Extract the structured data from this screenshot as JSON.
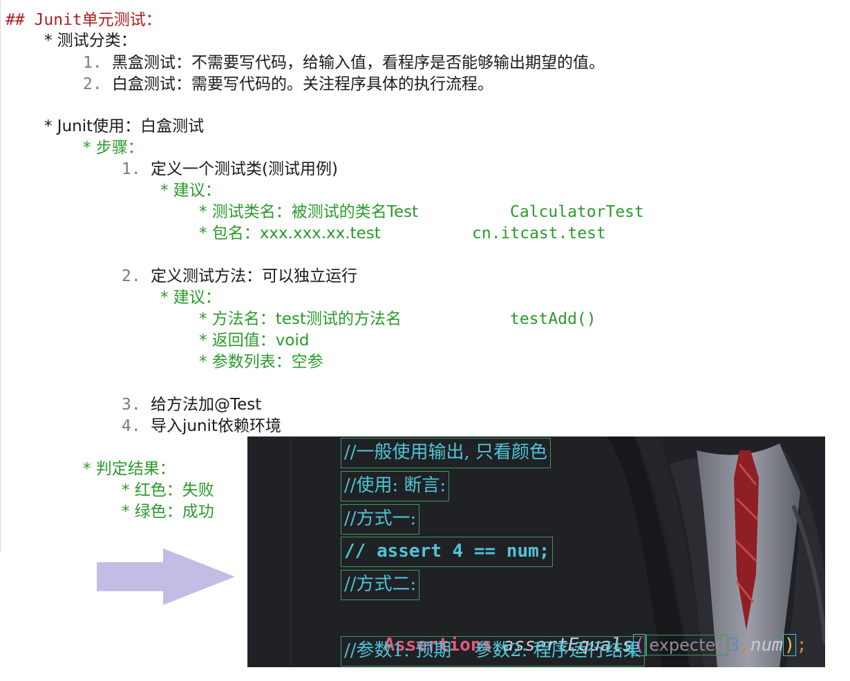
{
  "notes": {
    "heading": "## Junit单元测试：",
    "cat_title": "* 测试分类：",
    "cat_1_num": "1.",
    "cat_1": "黑盒测试：不需要写代码，给输入值，看程序是否能够输出期望的值。",
    "cat_2_num": "2.",
    "cat_2": "白盒测试：需要写代码的。关注程序具体的执行流程。",
    "use_title": "* Junit使用：白盒测试",
    "steps_title": "* 步骤：",
    "step1_num": "1.",
    "step1": "定义一个测试类(测试用例)",
    "suggest_1": "* 建议：",
    "s1_a": "* 测试类名：被测试的类名Test",
    "s1_a_ex": "CalculatorTest",
    "s1_b": "* 包名：xxx.xxx.xx.test",
    "s1_b_ex": "cn.itcast.test",
    "step2_num": "2.",
    "step2": "定义测试方法：可以独立运行",
    "suggest_2": "* 建议：",
    "s2_a": "* 方法名：test测试的方法名",
    "s2_a_ex": "testAdd()",
    "s2_b": "* 返回值：void",
    "s2_c": "* 参数列表：空参",
    "step3_num": "3.",
    "step3": "给方法加@Test",
    "step4_num": "4.",
    "step4": "导入junit依赖环境",
    "result_title": "* 判定结果：",
    "result_red": "* 红色：失败",
    "result_green": "* 绿色：成功"
  },
  "code": {
    "line1": "//一般使用输出, 只看颜色",
    "line2": "//使用: 断言:",
    "line3": "//方式一:",
    "line4": "// assert 4 == num;",
    "line5": "//方式二:",
    "line6_class": "Assertions",
    "line6_dot": ".",
    "line6_method": "assertEquals",
    "line6_open": "(",
    "line6_hint": "expected",
    "line6_arg1": "3",
    "line6_comma": ",",
    "line6_arg2": "num",
    "line6_close": ")",
    "line6_semi": ";",
    "line7": "//参数1: 预期    参数2: 程序运行结果"
  },
  "colors": {
    "heading": "#b01e1e",
    "green_text": "#2a9a2a",
    "editor_bg": "#1f2125",
    "comment": "#4fc6d6",
    "class_name": "#e45a7a",
    "arrow": "#c3bde6"
  }
}
